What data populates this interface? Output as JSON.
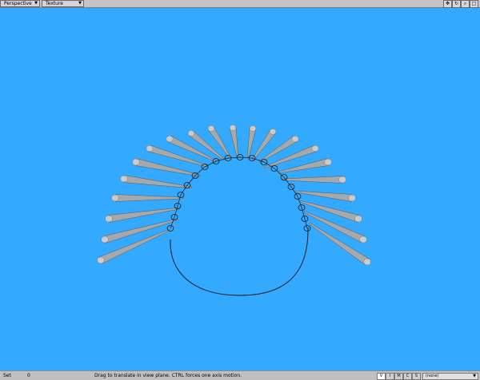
{
  "toolbar": {
    "view_mode": "Perspective",
    "shading_mode": "Texture",
    "icons": [
      "move-view-icon",
      "rotate-view-icon",
      "zoom-view-icon",
      "maximize-view-icon"
    ]
  },
  "viewport": {
    "background_color": "#33aaff",
    "tube_color": "#a6a9ab",
    "curve_color": "#1a1a1a"
  },
  "status": {
    "set_label": "Set",
    "frame_value": "0",
    "hint": "Drag to translate in view plane. CTRL forces one axis motion.",
    "modes": [
      "V",
      "I",
      "M",
      "C",
      "S"
    ],
    "active_mode": "V",
    "selection": "(none)"
  }
}
